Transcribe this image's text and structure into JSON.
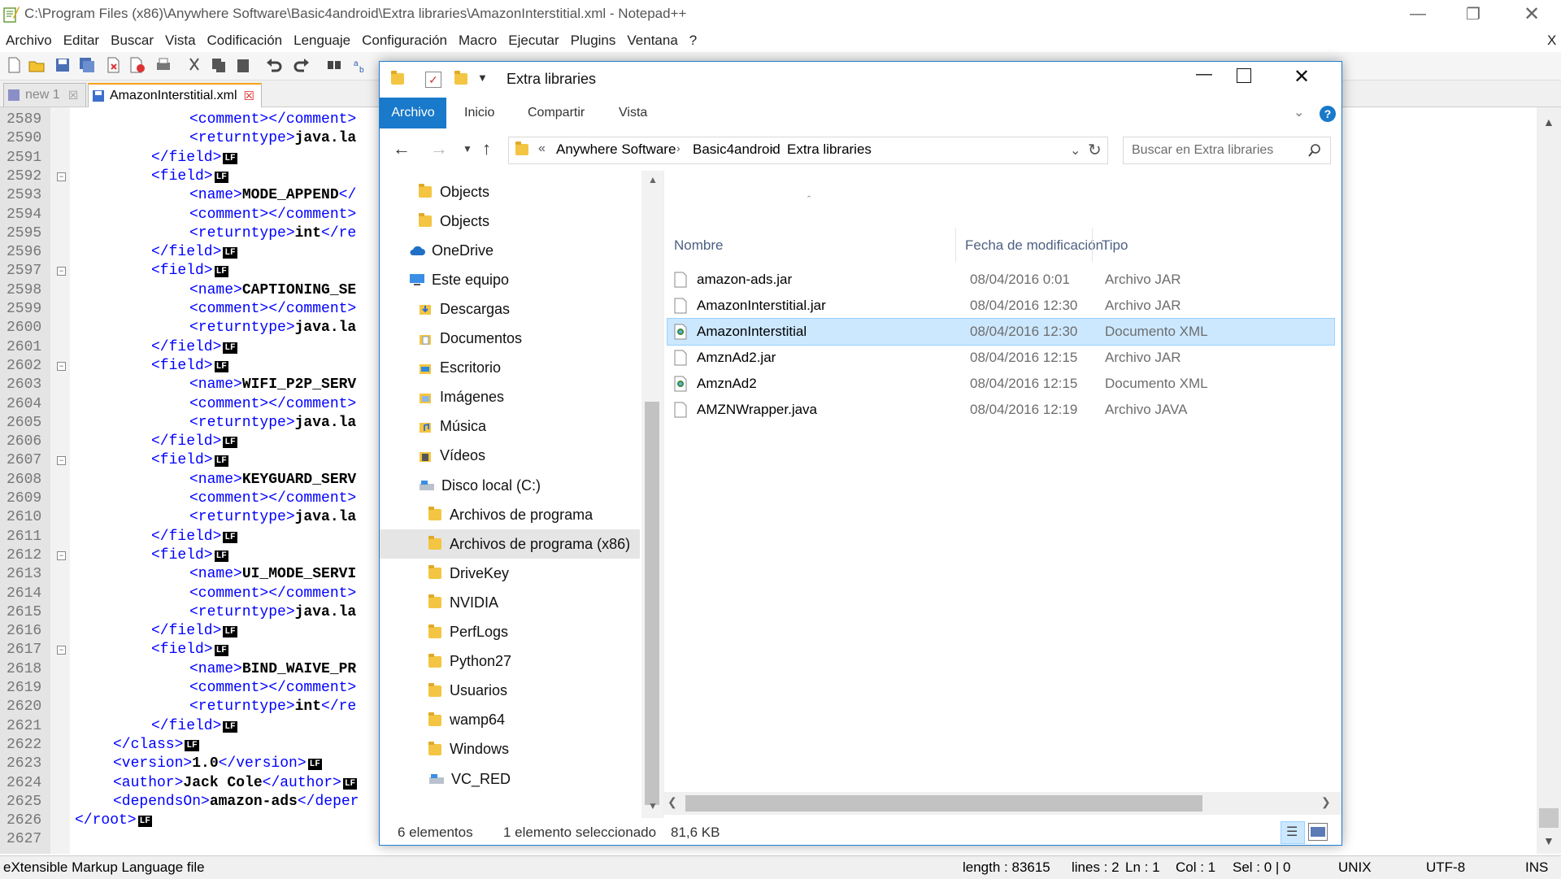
{
  "npp": {
    "title": "C:\\Program Files (x86)\\Anywhere Software\\Basic4android\\Extra libraries\\AmazonInterstitial.xml - Notepad++",
    "menu": [
      "Archivo",
      "Editar",
      "Buscar",
      "Vista",
      "Codificación",
      "Lenguaje",
      "Configuración",
      "Macro",
      "Ejecutar",
      "Plugins",
      "Ventana",
      "?"
    ],
    "close_doc": "X",
    "tabs": [
      {
        "label": "new 1",
        "active": false
      },
      {
        "label": "AmazonInterstitial.xml",
        "active": true
      }
    ],
    "lines": [
      {
        "n": "2589",
        "indent": 3,
        "parts": [
          [
            "tag",
            "<comment></comment>"
          ]
        ]
      },
      {
        "n": "2590",
        "indent": 3,
        "parts": [
          [
            "tag",
            "<returntype>"
          ],
          [
            "txt",
            "java.la"
          ]
        ]
      },
      {
        "n": "2591",
        "indent": 2,
        "parts": [
          [
            "tag",
            "</field>"
          ]
        ],
        "lf": true
      },
      {
        "n": "2592",
        "indent": 2,
        "parts": [
          [
            "tag",
            "<field>"
          ]
        ],
        "lf": true,
        "fold": true
      },
      {
        "n": "2593",
        "indent": 3,
        "parts": [
          [
            "tag",
            "<name>"
          ],
          [
            "txt",
            "MODE_APPEND"
          ],
          [
            "tag",
            "</"
          ]
        ]
      },
      {
        "n": "2594",
        "indent": 3,
        "parts": [
          [
            "tag",
            "<comment></comment>"
          ]
        ]
      },
      {
        "n": "2595",
        "indent": 3,
        "parts": [
          [
            "tag",
            "<returntype>"
          ],
          [
            "txt",
            "int"
          ],
          [
            "tag",
            "</re"
          ]
        ]
      },
      {
        "n": "2596",
        "indent": 2,
        "parts": [
          [
            "tag",
            "</field>"
          ]
        ],
        "lf": true
      },
      {
        "n": "2597",
        "indent": 2,
        "parts": [
          [
            "tag",
            "<field>"
          ]
        ],
        "lf": true,
        "fold": true
      },
      {
        "n": "2598",
        "indent": 3,
        "parts": [
          [
            "tag",
            "<name>"
          ],
          [
            "txt",
            "CAPTIONING_SE"
          ]
        ]
      },
      {
        "n": "2599",
        "indent": 3,
        "parts": [
          [
            "tag",
            "<comment></comment>"
          ]
        ]
      },
      {
        "n": "2600",
        "indent": 3,
        "parts": [
          [
            "tag",
            "<returntype>"
          ],
          [
            "txt",
            "java.la"
          ]
        ]
      },
      {
        "n": "2601",
        "indent": 2,
        "parts": [
          [
            "tag",
            "</field>"
          ]
        ],
        "lf": true
      },
      {
        "n": "2602",
        "indent": 2,
        "parts": [
          [
            "tag",
            "<field>"
          ]
        ],
        "lf": true,
        "fold": true
      },
      {
        "n": "2603",
        "indent": 3,
        "parts": [
          [
            "tag",
            "<name>"
          ],
          [
            "txt",
            "WIFI_P2P_SERV"
          ]
        ]
      },
      {
        "n": "2604",
        "indent": 3,
        "parts": [
          [
            "tag",
            "<comment></comment>"
          ]
        ]
      },
      {
        "n": "2605",
        "indent": 3,
        "parts": [
          [
            "tag",
            "<returntype>"
          ],
          [
            "txt",
            "java.la"
          ]
        ]
      },
      {
        "n": "2606",
        "indent": 2,
        "parts": [
          [
            "tag",
            "</field>"
          ]
        ],
        "lf": true
      },
      {
        "n": "2607",
        "indent": 2,
        "parts": [
          [
            "tag",
            "<field>"
          ]
        ],
        "lf": true,
        "fold": true
      },
      {
        "n": "2608",
        "indent": 3,
        "parts": [
          [
            "tag",
            "<name>"
          ],
          [
            "txt",
            "KEYGUARD_SERV"
          ]
        ]
      },
      {
        "n": "2609",
        "indent": 3,
        "parts": [
          [
            "tag",
            "<comment></comment>"
          ]
        ]
      },
      {
        "n": "2610",
        "indent": 3,
        "parts": [
          [
            "tag",
            "<returntype>"
          ],
          [
            "txt",
            "java.la"
          ]
        ]
      },
      {
        "n": "2611",
        "indent": 2,
        "parts": [
          [
            "tag",
            "</field>"
          ]
        ],
        "lf": true
      },
      {
        "n": "2612",
        "indent": 2,
        "parts": [
          [
            "tag",
            "<field>"
          ]
        ],
        "lf": true,
        "fold": true
      },
      {
        "n": "2613",
        "indent": 3,
        "parts": [
          [
            "tag",
            "<name>"
          ],
          [
            "txt",
            "UI_MODE_SERVI"
          ]
        ]
      },
      {
        "n": "2614",
        "indent": 3,
        "parts": [
          [
            "tag",
            "<comment></comment>"
          ]
        ]
      },
      {
        "n": "2615",
        "indent": 3,
        "parts": [
          [
            "tag",
            "<returntype>"
          ],
          [
            "txt",
            "java.la"
          ]
        ]
      },
      {
        "n": "2616",
        "indent": 2,
        "parts": [
          [
            "tag",
            "</field>"
          ]
        ],
        "lf": true
      },
      {
        "n": "2617",
        "indent": 2,
        "parts": [
          [
            "tag",
            "<field>"
          ]
        ],
        "lf": true,
        "fold": true
      },
      {
        "n": "2618",
        "indent": 3,
        "parts": [
          [
            "tag",
            "<name>"
          ],
          [
            "txt",
            "BIND_WAIVE_PR"
          ]
        ]
      },
      {
        "n": "2619",
        "indent": 3,
        "parts": [
          [
            "tag",
            "<comment></comment>"
          ]
        ]
      },
      {
        "n": "2620",
        "indent": 3,
        "parts": [
          [
            "tag",
            "<returntype>"
          ],
          [
            "txt",
            "int"
          ],
          [
            "tag",
            "</re"
          ]
        ]
      },
      {
        "n": "2621",
        "indent": 2,
        "parts": [
          [
            "tag",
            "</field>"
          ]
        ],
        "lf": true
      },
      {
        "n": "2622",
        "indent": 1,
        "parts": [
          [
            "tag",
            "</class>"
          ]
        ],
        "lf": true
      },
      {
        "n": "2623",
        "indent": 1,
        "parts": [
          [
            "tag",
            "<version>"
          ],
          [
            "txt",
            "1.0"
          ],
          [
            "tag",
            "</version>"
          ]
        ],
        "lf": true
      },
      {
        "n": "2624",
        "indent": 1,
        "parts": [
          [
            "tag",
            "<author>"
          ],
          [
            "txt",
            "Jack Cole"
          ],
          [
            "tag",
            "</author>"
          ]
        ],
        "lf": true
      },
      {
        "n": "2625",
        "indent": 1,
        "parts": [
          [
            "tag",
            "<dependsOn>"
          ],
          [
            "txt",
            "amazon-ads"
          ],
          [
            "tag",
            "</deper"
          ]
        ]
      },
      {
        "n": "2626",
        "indent": 0,
        "parts": [
          [
            "tag",
            "</root>"
          ]
        ],
        "lf": true
      },
      {
        "n": "2627",
        "indent": 0,
        "parts": []
      }
    ],
    "lf_label": "LF",
    "status": {
      "filetype": "eXtensible Markup Language file",
      "length": "length : 83615",
      "lines": "lines : 2",
      "ln": "Ln : 1",
      "col": "Col : 1",
      "sel": "Sel : 0 | 0",
      "eol": "UNIX",
      "encoding": "UTF-8",
      "mode": "INS"
    }
  },
  "explorer": {
    "title": "Extra libraries",
    "ribbon": [
      "Archivo",
      "Inicio",
      "Compartir",
      "Vista"
    ],
    "breadcrumb": [
      "«",
      "Anywhere Software",
      "Basic4android",
      "Extra libraries"
    ],
    "search_placeholder": "Buscar en Extra libraries",
    "nav": [
      {
        "label": "Objects",
        "level": 1,
        "icon": "folder"
      },
      {
        "label": "Objects",
        "level": 1,
        "icon": "folder"
      },
      {
        "label": "OneDrive",
        "level": 0,
        "icon": "cloud"
      },
      {
        "label": "Este equipo",
        "level": 0,
        "icon": "pc"
      },
      {
        "label": "Descargas",
        "level": 1,
        "icon": "download"
      },
      {
        "label": "Documentos",
        "level": 1,
        "icon": "docs"
      },
      {
        "label": "Escritorio",
        "level": 1,
        "icon": "desktop"
      },
      {
        "label": "Imágenes",
        "level": 1,
        "icon": "pictures"
      },
      {
        "label": "Música",
        "level": 1,
        "icon": "music"
      },
      {
        "label": "Vídeos",
        "level": 1,
        "icon": "videos"
      },
      {
        "label": "Disco local (C:)",
        "level": 1,
        "icon": "drive"
      },
      {
        "label": "Archivos de programa",
        "level": 2,
        "icon": "folder"
      },
      {
        "label": "Archivos de programa (x86)",
        "level": 2,
        "icon": "folder",
        "selected": true
      },
      {
        "label": "DriveKey",
        "level": 2,
        "icon": "folder"
      },
      {
        "label": "NVIDIA",
        "level": 2,
        "icon": "folder"
      },
      {
        "label": "PerfLogs",
        "level": 2,
        "icon": "folder"
      },
      {
        "label": "Python27",
        "level": 2,
        "icon": "folder"
      },
      {
        "label": "Usuarios",
        "level": 2,
        "icon": "folder"
      },
      {
        "label": "wamp64",
        "level": 2,
        "icon": "folder"
      },
      {
        "label": "Windows",
        "level": 2,
        "icon": "folder"
      },
      {
        "label": "VC_RED",
        "level": 2,
        "icon": "drive"
      }
    ],
    "columns": {
      "name": "Nombre",
      "date": "Fecha de modificación",
      "type": "Tipo"
    },
    "files": [
      {
        "name": "amazon-ads.jar",
        "date": "08/04/2016 0:01",
        "type": "Archivo JAR",
        "icon": "file"
      },
      {
        "name": "AmazonInterstitial.jar",
        "date": "08/04/2016 12:30",
        "type": "Archivo JAR",
        "icon": "file"
      },
      {
        "name": "AmazonInterstitial",
        "date": "08/04/2016 12:30",
        "type": "Documento XML",
        "icon": "xml",
        "selected": true
      },
      {
        "name": "AmznAd2.jar",
        "date": "08/04/2016 12:15",
        "type": "Archivo JAR",
        "icon": "file"
      },
      {
        "name": "AmznAd2",
        "date": "08/04/2016 12:15",
        "type": "Documento XML",
        "icon": "xml"
      },
      {
        "name": "AMZNWrapper.java",
        "date": "08/04/2016 12:19",
        "type": "Archivo JAVA",
        "icon": "file"
      }
    ],
    "status": {
      "count": "6 elementos",
      "selected": "1 elemento seleccionado",
      "size": "81,6 KB"
    },
    "colors": {
      "accent": "#1979ca",
      "selection": "#cce8ff",
      "nav_selected": "#e5e5e5"
    }
  }
}
